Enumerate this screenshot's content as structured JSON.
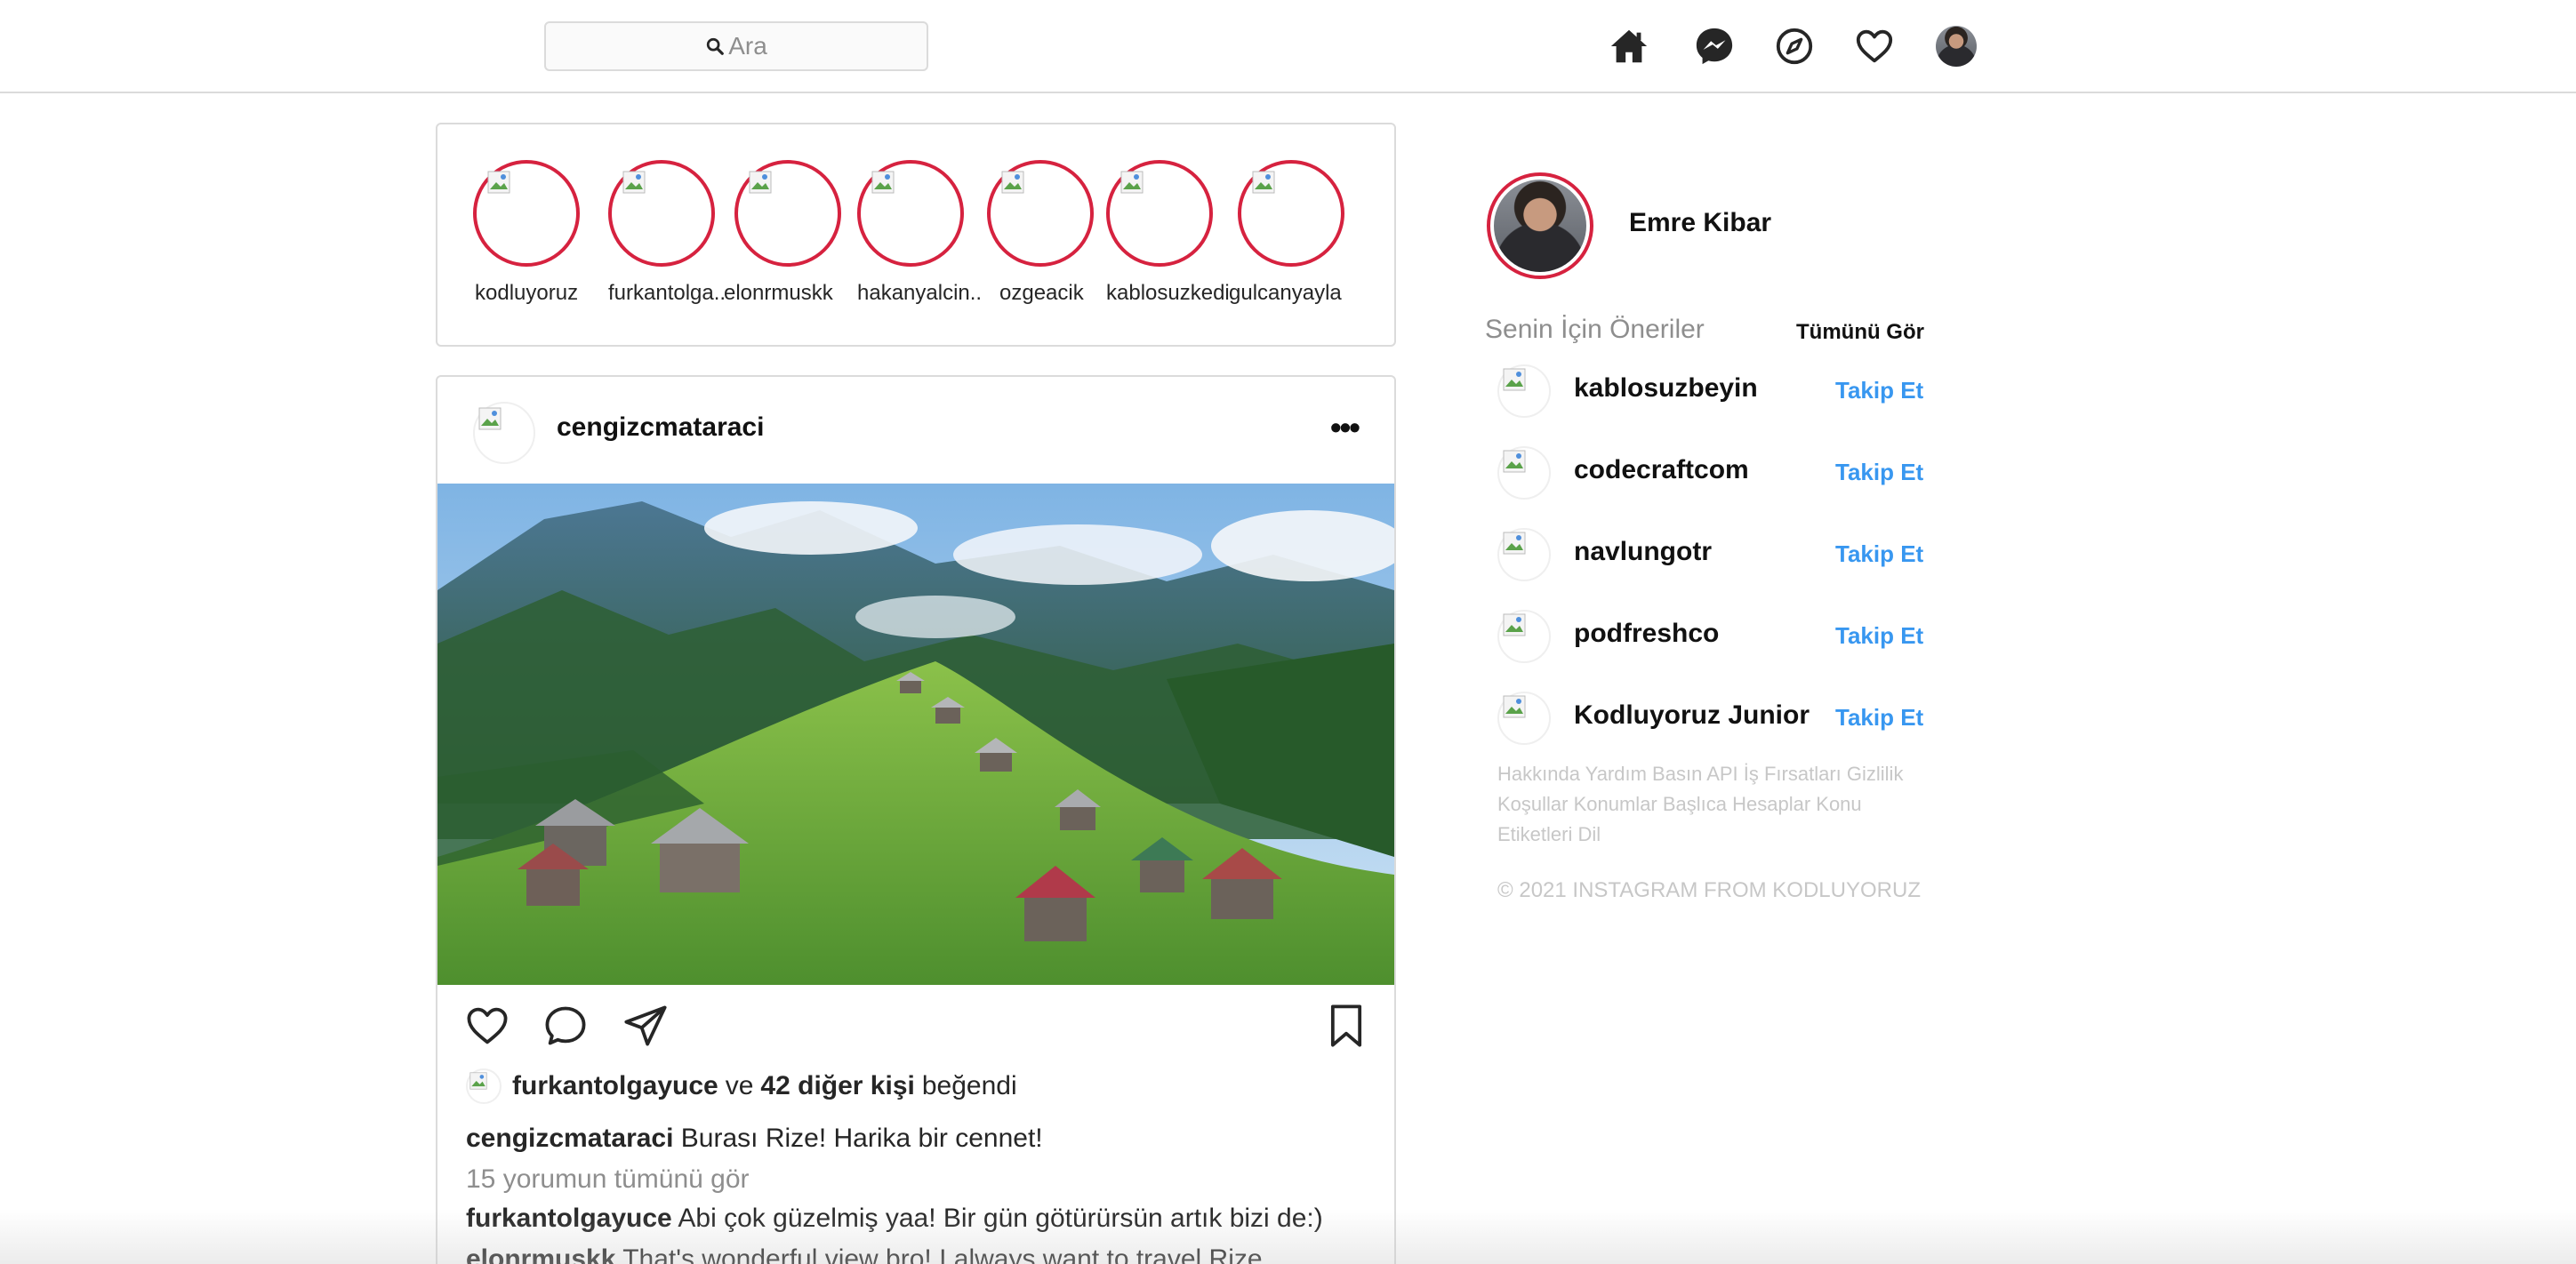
{
  "header": {
    "search_placeholder": "Ara",
    "nav_icons": [
      "home-icon",
      "messenger-icon",
      "explore-compass-icon",
      "heart-icon",
      "profile-avatar"
    ]
  },
  "stories": [
    {
      "name": "kodluyoruz"
    },
    {
      "name": "furkantolga.."
    },
    {
      "name": "elonrmuskk"
    },
    {
      "name": "hakanyalcin.."
    },
    {
      "name": "ozgeacik"
    },
    {
      "name": "kablosuzkedi"
    },
    {
      "name": "gulcanyayla"
    }
  ],
  "post": {
    "username": "cengizcmataraci",
    "more_label": "•••",
    "likes": {
      "user": "furkantolgayuce",
      "connector": "ve",
      "others": "42 diğer kişi",
      "suffix": "beğendi"
    },
    "caption": {
      "user": "cengizcmataraci",
      "text": "Burası Rize! Harika bir cennet!"
    },
    "view_all_comments": "15 yorumun tümünü gör",
    "comments": [
      {
        "user": "furkantolgayuce",
        "text": "Abi çok güzelmiş yaa! Bir gün götürürsün artık bizi de:)"
      },
      {
        "user": "elonrmuskk",
        "text": "That's wonderful view bro! I always want to travel Rize"
      }
    ]
  },
  "sidebar": {
    "profile_name": "Emre Kibar",
    "suggestions_title": "Senin İçin Öneriler",
    "see_all": "Tümünü Gör",
    "follow_label": "Takip Et",
    "suggestions": [
      {
        "name": "kablosuzbeyin"
      },
      {
        "name": "codecraftcom"
      },
      {
        "name": "navlungotr"
      },
      {
        "name": "podfreshco"
      },
      {
        "name": "Kodluyoruz Junior"
      }
    ],
    "footer_links": "Hakkında Yardım Basın API İş Fırsatları Gizlilik Koşullar Konumlar Başlıca Hesaplar Konu Etiketleri Dil",
    "copyright": "© 2021 INSTAGRAM FROM KODLUYORUZ"
  },
  "colors": {
    "story_ring": "#d6223f",
    "follow_link": "#3897f0",
    "border": "#dbdbdb",
    "muted_text": "#8e8e8e"
  }
}
